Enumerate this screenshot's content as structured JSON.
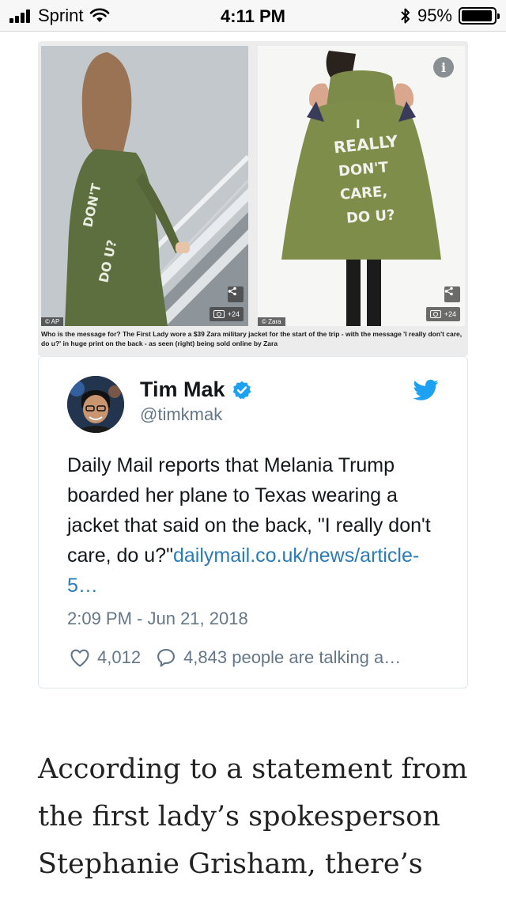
{
  "status_bar": {
    "carrier": "Sprint",
    "time": "4:11 PM",
    "battery_percent": "95%",
    "battery_level": 0.95,
    "icons": [
      "signal-icon",
      "wifi-icon",
      "bluetooth-icon",
      "battery-icon"
    ]
  },
  "article_image": {
    "left_credit": "© AP",
    "right_credit": "© Zara",
    "gallery_count": "+24",
    "jacket_text": [
      "I",
      "REALLY",
      "DON'T",
      "CARE,",
      "DO U?"
    ],
    "caption": "Who is the message for? The First Lady wore a $39 Zara military jacket for the start of the trip - with the message 'I really don't care, do u?' in huge print on the back - as seen (right) being sold online by Zara",
    "icons": [
      "share-icon",
      "camera-icon",
      "info-icon"
    ]
  },
  "tweet": {
    "author_name": "Tim Mak",
    "handle": "@timkmak",
    "text": "Daily Mail reports that Melania Trump boarded her plane to Texas wearing a jacket that said on the back, \"I really don't care, do u?\"",
    "link": "dailymail.co.uk/news/article-5…",
    "timestamp": "2:09 PM - Jun 21, 2018",
    "likes": "4,012",
    "replies": "4,843 people are talking a…",
    "colors": {
      "link": "#2b7bb9",
      "twitter_blue": "#1da1f2",
      "secondary": "#657786"
    }
  },
  "article": {
    "paragraph": "According to a statement from the first lady’s spokesperson Stephanie Grisham, there’s"
  }
}
